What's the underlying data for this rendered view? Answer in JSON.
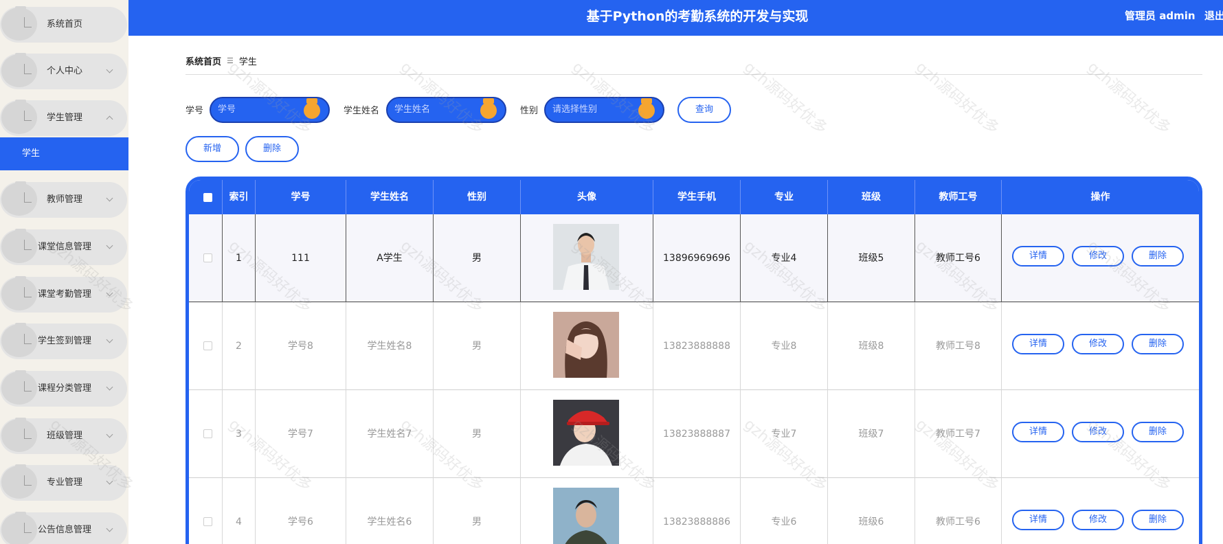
{
  "header": {
    "title": "基于Python的考勤系统的开发与实现",
    "user": "管理员 admin",
    "logout": "退出"
  },
  "sidebar": {
    "items": [
      {
        "label": "系统首页",
        "has_chevron": false
      },
      {
        "label": "个人中心",
        "has_chevron": true
      },
      {
        "label": "学生管理",
        "has_chevron": true,
        "expanded": true
      },
      {
        "label": "教师管理",
        "has_chevron": true
      },
      {
        "label": "课堂信息管理",
        "has_chevron": true
      },
      {
        "label": "课堂考勤管理",
        "has_chevron": true
      },
      {
        "label": "学生签到管理",
        "has_chevron": true
      },
      {
        "label": "课程分类管理",
        "has_chevron": true
      },
      {
        "label": "班级管理",
        "has_chevron": true
      },
      {
        "label": "专业管理",
        "has_chevron": true
      },
      {
        "label": "公告信息管理",
        "has_chevron": true
      }
    ],
    "active_sub": "学生"
  },
  "breadcrumb": {
    "home": "系统首页",
    "current": "学生"
  },
  "search": {
    "fields": [
      {
        "label": "学号",
        "placeholder": "学号"
      },
      {
        "label": "学生姓名",
        "placeholder": "学生姓名"
      },
      {
        "label": "性别",
        "placeholder": "请选择性别"
      }
    ],
    "query_button": "查询"
  },
  "actions": {
    "add": "新增",
    "delete": "删除"
  },
  "table": {
    "columns": [
      "索引",
      "学号",
      "学生姓名",
      "性别",
      "头像",
      "学生手机",
      "专业",
      "班级",
      "教师工号",
      "操作"
    ],
    "rows": [
      {
        "index": "1",
        "student_no": "111",
        "name": "A学生",
        "gender": "男",
        "avatar": "avatar-photo-1",
        "phone": "13896969696",
        "major": "专业4",
        "class": "班级5",
        "teacher_no": "教师工号6"
      },
      {
        "index": "2",
        "student_no": "学号8",
        "name": "学生姓名8",
        "gender": "男",
        "avatar": "avatar-photo-2",
        "phone": "13823888888",
        "major": "专业8",
        "class": "班级8",
        "teacher_no": "教师工号8"
      },
      {
        "index": "3",
        "student_no": "学号7",
        "name": "学生姓名7",
        "gender": "男",
        "avatar": "avatar-photo-3",
        "phone": "13823888887",
        "major": "专业7",
        "class": "班级7",
        "teacher_no": "教师工号7"
      },
      {
        "index": "4",
        "student_no": "学号6",
        "name": "学生姓名6",
        "gender": "男",
        "avatar": "avatar-photo-4",
        "phone": "13823888886",
        "major": "专业6",
        "class": "班级6",
        "teacher_no": "教师工号6"
      }
    ],
    "row_actions": [
      "详情",
      "修改",
      "删除"
    ]
  },
  "watermark": "gzh源码好优多",
  "colors": {
    "primary": "#2563f0",
    "sidebar_bg": "#f4f1ea",
    "knob": "#f5a530"
  }
}
